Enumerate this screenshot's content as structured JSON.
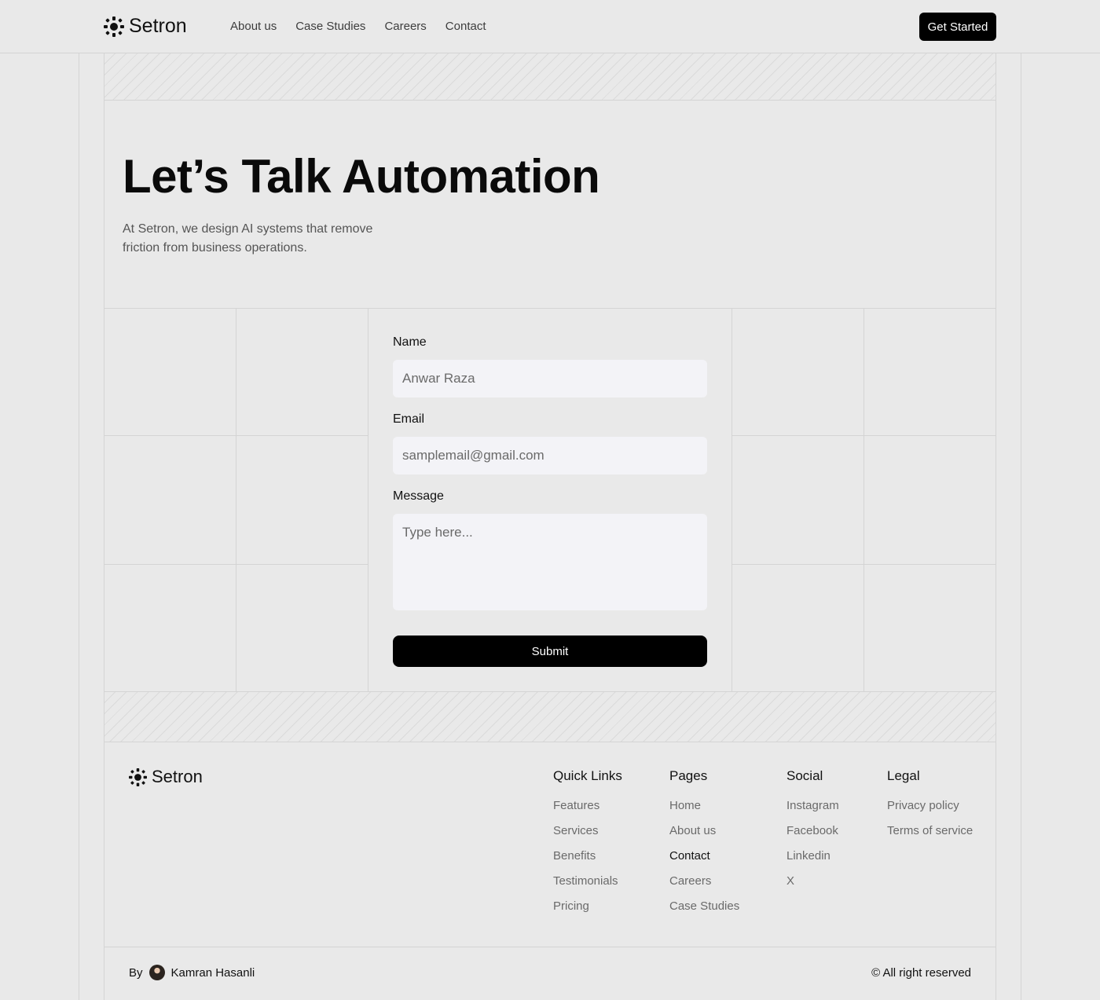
{
  "brand": {
    "name": "Setron",
    "logo_icon": "setron-logo-icon"
  },
  "nav": {
    "items": [
      "About us",
      "Case Studies",
      "Careers",
      "Contact"
    ]
  },
  "header": {
    "cta_label": "Get Started"
  },
  "hero": {
    "title": "Let’s Talk Automation",
    "subtitle": "At Setron, we design AI systems that remove friction from business operations."
  },
  "form": {
    "name_label": "Name",
    "name_placeholder": "Anwar Raza",
    "email_label": "Email",
    "email_placeholder": "samplemail@gmail.com",
    "message_label": "Message",
    "message_placeholder": "Type here...",
    "submit_label": "Submit"
  },
  "footer": {
    "columns": [
      {
        "title": "Quick Links",
        "links": [
          "Features",
          "Services",
          "Benefits",
          "Testimonials",
          "Pricing"
        ]
      },
      {
        "title": "Pages",
        "links": [
          "Home",
          "About us",
          "Contact",
          "Careers",
          "Case Studies"
        ],
        "active": "Contact"
      },
      {
        "title": "Social",
        "links": [
          "Instagram",
          "Facebook",
          "Linkedin",
          "X"
        ]
      },
      {
        "title": "Legal",
        "links": [
          "Privacy policy",
          "Terms of service"
        ]
      }
    ],
    "by_label": "By",
    "author": "Kamran Hasanli",
    "rights": "© All right reserved"
  },
  "colors": {
    "background": "#e9e9e9",
    "accent": "#000000",
    "field_bg": "#f3f3f7"
  }
}
